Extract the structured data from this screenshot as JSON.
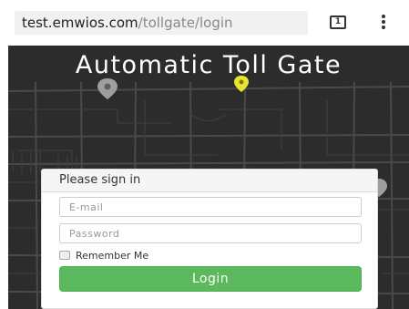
{
  "browser": {
    "url_host": "test.emwios.com",
    "url_path": "/tollgate/login",
    "tab_count": "1"
  },
  "page": {
    "title": "Automatic Toll Gate"
  },
  "login_panel": {
    "heading": "Please sign in",
    "email_placeholder": "E-mail",
    "password_placeholder": "Password",
    "remember_label": "Remember Me",
    "login_label": "Login"
  },
  "colors": {
    "map_background": "#2c2c2c",
    "login_button": "#5cb85c",
    "pin_gray": "#9e9e9e",
    "pin_yellow": "#e6e62e",
    "pin_green": "#3aa83a"
  },
  "icons": {
    "tabs": "tab-switcher-icon",
    "menu": "overflow-menu-icon",
    "pins": "map-marker-icon"
  }
}
